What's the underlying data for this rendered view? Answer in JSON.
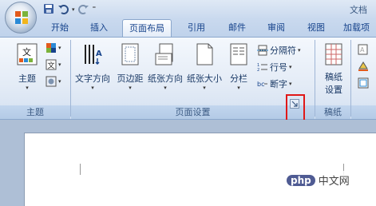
{
  "window": {
    "title": "文档"
  },
  "qat": {
    "save_icon": "save-icon",
    "undo_icon": "undo-icon",
    "redo_icon": "redo-icon"
  },
  "tabs": [
    {
      "label": "开始"
    },
    {
      "label": "插入"
    },
    {
      "label": "页面布局",
      "active": true
    },
    {
      "label": "引用"
    },
    {
      "label": "邮件"
    },
    {
      "label": "审阅"
    },
    {
      "label": "视图"
    },
    {
      "label": "加载项"
    }
  ],
  "groups": {
    "themes": {
      "label": "主题",
      "buttons": {
        "theme": "主题"
      }
    },
    "page_setup": {
      "label": "页面设置",
      "buttons": {
        "text_direction": "文字方向",
        "margins": "页边距",
        "orientation": "纸张方向",
        "size": "纸张大小",
        "columns": "分栏",
        "breaks": "分隔符",
        "line_numbers": "行号",
        "hyphenation": "断字"
      }
    },
    "manuscript": {
      "label": "稿纸",
      "buttons": {
        "setup_line1": "稿纸",
        "setup_line2": "设置"
      }
    }
  },
  "watermark": {
    "logo": "php",
    "text": "中文网"
  },
  "colors": {
    "highlight_box": "#e01818",
    "accent": "#15428b"
  }
}
